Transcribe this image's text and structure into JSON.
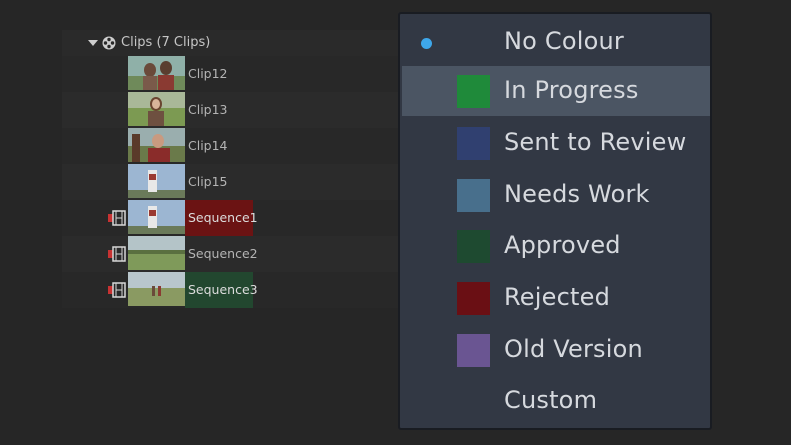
{
  "bin": {
    "title": "Clips (7 Clips)",
    "clips": [
      {
        "label": "Clip12"
      },
      {
        "label": "Clip13"
      },
      {
        "label": "Clip14"
      },
      {
        "label": "Clip15"
      }
    ],
    "sequences": [
      {
        "label": "Sequence1",
        "color": "#6b1313"
      },
      {
        "label": "Sequence2",
        "color": ""
      },
      {
        "label": "Sequence3",
        "color": "#22472f"
      }
    ]
  },
  "colour_menu": {
    "items": [
      {
        "label": "No Colour",
        "swatch": "",
        "selected": true,
        "highlighted": false
      },
      {
        "label": "In Progress",
        "swatch": "#1f8a3a",
        "selected": false,
        "highlighted": true
      },
      {
        "label": "Sent to Review",
        "swatch": "#304070",
        "selected": false,
        "highlighted": false
      },
      {
        "label": "Needs Work",
        "swatch": "#486f8c",
        "selected": false,
        "highlighted": false
      },
      {
        "label": "Approved",
        "swatch": "#1e4a30",
        "selected": false,
        "highlighted": false
      },
      {
        "label": "Rejected",
        "swatch": "#6a0f14",
        "selected": false,
        "highlighted": false
      },
      {
        "label": "Old Version",
        "swatch": "#6a5592",
        "selected": false,
        "highlighted": false
      },
      {
        "label": "Custom",
        "swatch": "",
        "selected": false,
        "highlighted": false
      }
    ]
  }
}
